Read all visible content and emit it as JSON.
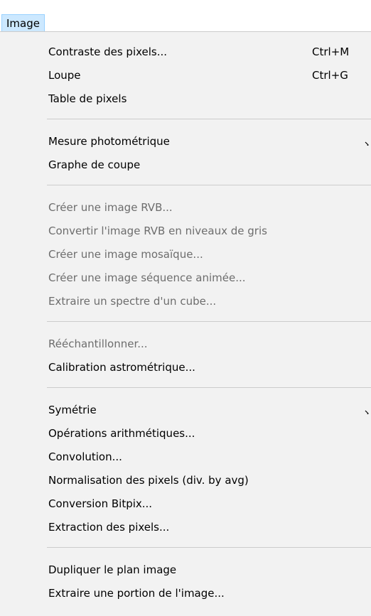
{
  "menu": {
    "title": "Image"
  },
  "items": {
    "contraste": {
      "label": "Contraste des pixels...",
      "shortcut": "Ctrl+M"
    },
    "loupe": {
      "label": "Loupe",
      "shortcut": "Ctrl+G"
    },
    "table": {
      "label": "Table de pixels"
    },
    "mesure": {
      "label": "Mesure photométrique"
    },
    "graphe": {
      "label": "Graphe de coupe"
    },
    "creer_rvb": {
      "label": "Créer une image RVB..."
    },
    "convertir": {
      "label": "Convertir l'image RVB en niveaux de gris"
    },
    "mosaique": {
      "label": "Créer une image mosaïque..."
    },
    "sequence": {
      "label": "Créer une image séquence animée..."
    },
    "spectre": {
      "label": "Extraire un spectre d'un cube..."
    },
    "reechant": {
      "label": "Rééchantillonner..."
    },
    "calibration": {
      "label": "Calibration astrométrique..."
    },
    "symetrie": {
      "label": "Symétrie"
    },
    "operations": {
      "label": "Opérations arithmétiques..."
    },
    "convolution": {
      "label": "Convolution..."
    },
    "normalisation": {
      "label": "Normalisation des pixels (div. by avg)"
    },
    "bitpix": {
      "label": "Conversion Bitpix..."
    },
    "extraction": {
      "label": "Extraction des pixels..."
    },
    "dupliquer": {
      "label": "Dupliquer le plan image"
    },
    "portion": {
      "label": "Extraire une portion de l'image..."
    }
  },
  "colors": {
    "menu_bg": "#f2f2f2",
    "title_highlight": "#cce8ff",
    "disabled_text": "#6d6d6d",
    "separator": "#cccccc"
  },
  "icons": {
    "submenu_arrow": "chevron-right-icon"
  }
}
